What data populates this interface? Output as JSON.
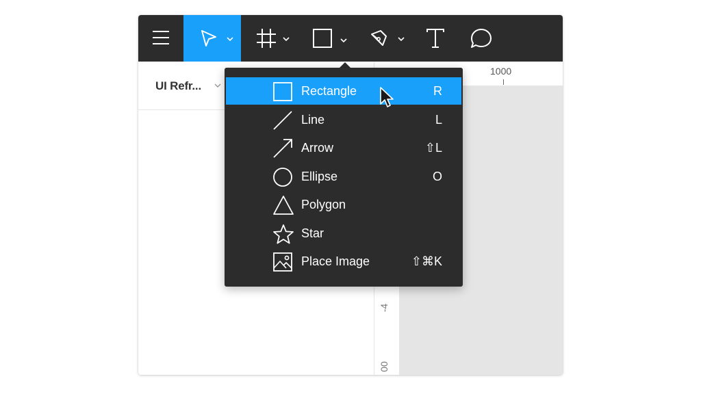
{
  "toolbar": {
    "buttons": [
      {
        "name": "menu",
        "icon": "hamburger-menu-icon"
      },
      {
        "name": "move",
        "icon": "pointer-arrow-icon",
        "active": true
      },
      {
        "name": "frame",
        "icon": "frame-hash-icon"
      },
      {
        "name": "shape",
        "icon": "square-shape-icon"
      },
      {
        "name": "pen",
        "icon": "pen-nib-icon"
      },
      {
        "name": "text",
        "icon": "text-t-icon"
      },
      {
        "name": "comment",
        "icon": "speech-bubble-icon"
      }
    ]
  },
  "left_panel": {
    "file_name": "UI Refr..."
  },
  "rulers": {
    "horizontal_label": "1000",
    "vertical_labels": [
      "-4",
      "00"
    ]
  },
  "shape_menu": {
    "items": [
      {
        "label": "Rectangle",
        "shortcut": "R",
        "icon": "rectangle-icon",
        "highlighted": true
      },
      {
        "label": "Line",
        "shortcut": "L",
        "icon": "line-icon"
      },
      {
        "label": "Arrow",
        "shortcut": "⇧L",
        "icon": "arrow-icon"
      },
      {
        "label": "Ellipse",
        "shortcut": "O",
        "icon": "ellipse-icon"
      },
      {
        "label": "Polygon",
        "shortcut": "",
        "icon": "polygon-icon"
      },
      {
        "label": "Star",
        "shortcut": "",
        "icon": "star-icon"
      },
      {
        "label": "Place Image",
        "shortcut": "⇧⌘K",
        "icon": "image-icon"
      }
    ]
  },
  "colors": {
    "toolbar_bg": "#2c2c2c",
    "accent": "#18a0fb",
    "canvas_bg": "#e5e5e5"
  }
}
